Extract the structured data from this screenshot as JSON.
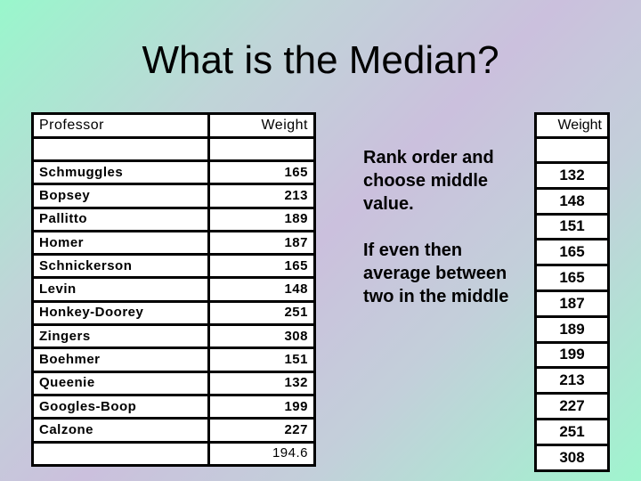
{
  "slide": {
    "title": "What is the Median?",
    "background_colors": [
      "#99f7cc",
      "#cbc0dd",
      "#9ff5ce"
    ]
  },
  "left_table": {
    "headers": [
      "Professor",
      "Weight"
    ],
    "rows": [
      {
        "name": "Schmuggles",
        "weight": "165"
      },
      {
        "name": "Bopsey",
        "weight": "213"
      },
      {
        "name": "Pallitto",
        "weight": "189"
      },
      {
        "name": "Homer",
        "weight": "187"
      },
      {
        "name": "Schnickerson",
        "weight": "165"
      },
      {
        "name": "Levin",
        "weight": "148"
      },
      {
        "name": "Honkey-Doorey",
        "weight": "251"
      },
      {
        "name": "Zingers",
        "weight": "308"
      },
      {
        "name": "Boehmer",
        "weight": "151"
      },
      {
        "name": "Queenie",
        "weight": "132"
      },
      {
        "name": "Googles-Boop",
        "weight": "199"
      },
      {
        "name": "Calzone",
        "weight": "227"
      }
    ],
    "footer_value": "194.6"
  },
  "notes": {
    "rank_order": "Rank order and choose middle value.",
    "if_even": "If even then average between two in the middle"
  },
  "right_table": {
    "header": "Weight",
    "values": [
      "132",
      "148",
      "151",
      "165",
      "165",
      "187",
      "189",
      "199",
      "213",
      "227",
      "251",
      "308"
    ]
  }
}
